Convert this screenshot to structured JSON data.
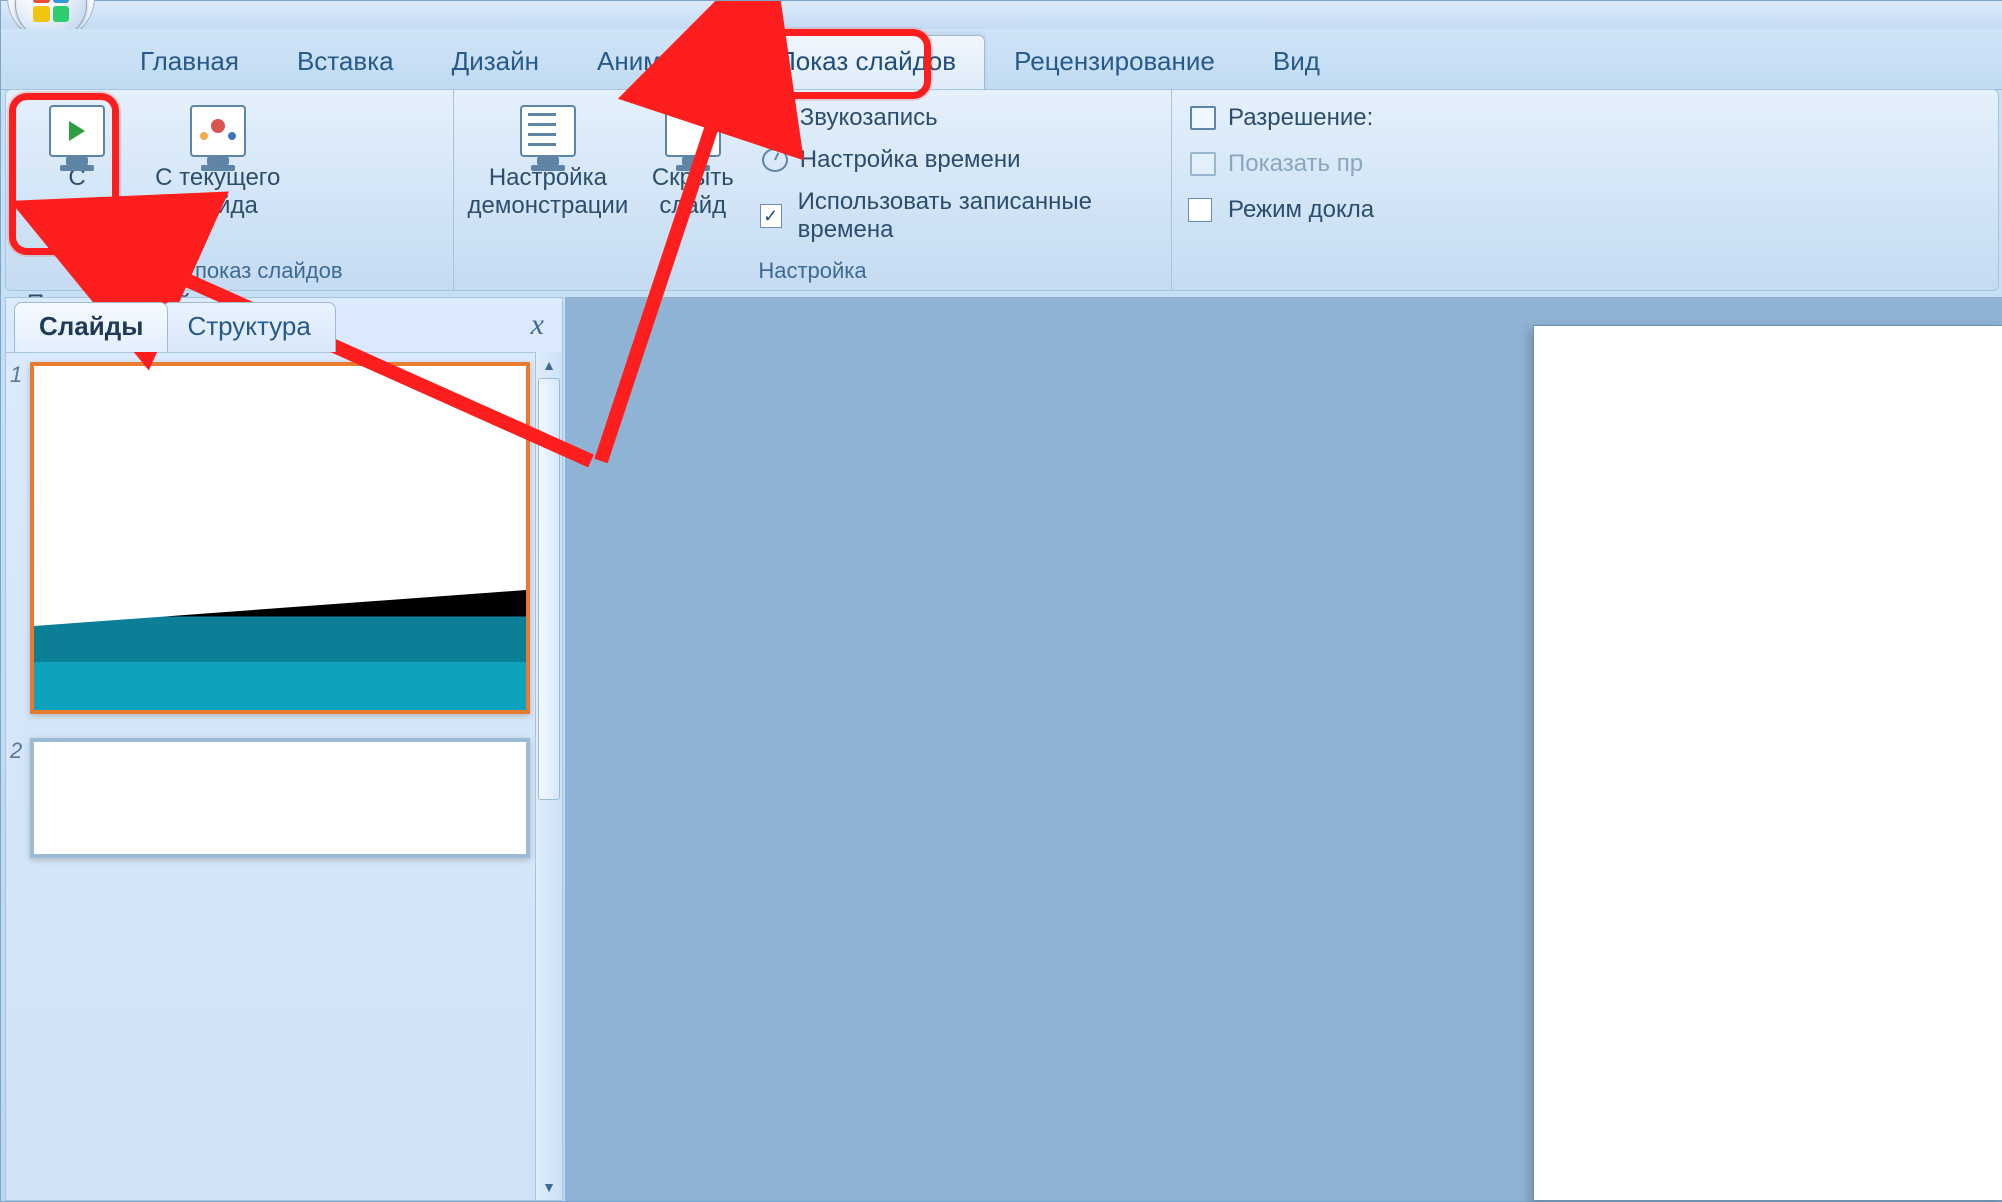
{
  "tabs": {
    "home": "Главная",
    "insert": "Вставка",
    "design": "Дизайн",
    "animation": "Анимация",
    "slideshow": "Показ слайдов",
    "review": "Рецензирование",
    "view": "Вид"
  },
  "ribbon": {
    "start_group_title": "Начать показ слайдов",
    "from_beginning": "С\nначала",
    "from_current": "С текущего\nслайда",
    "custom_show": "Произвольный\nпоказ",
    "setup_group_title": "Настройка",
    "setup_show": "Настройка\nдемонстрации",
    "hide_slide": "Скрыть\nслайд",
    "record_narration": "Звукозапись",
    "rehearse_timings": "Настройка времени",
    "use_rehearsed": "Использовать записанные времена",
    "resolution": "Разрешение:",
    "show_on": "Показать пр",
    "presenter_view": "Режим докла"
  },
  "left_pane": {
    "tab_slides": "Слайды",
    "tab_outline": "Структура",
    "close": "x",
    "slide1_num": "1",
    "slide2_num": "2"
  }
}
